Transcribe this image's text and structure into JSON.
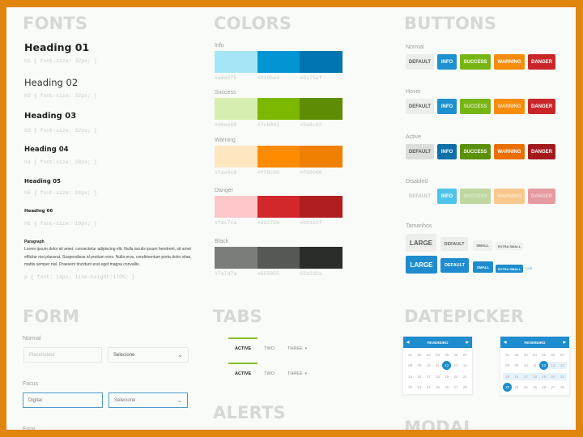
{
  "fonts": {
    "title": "FONTS",
    "headings": [
      {
        "label": "Heading 01",
        "spec": "h1 { font-size: 32px; }"
      },
      {
        "label": "Heading 02",
        "spec": "h2 { font-size: 32px; }"
      },
      {
        "label": "Heading 03",
        "spec": "h3 { font-size: 32px; }"
      },
      {
        "label": "Heading 04",
        "spec": "h4 { font-size: 28px; }"
      },
      {
        "label": "Heading 05",
        "spec": "h5 { font-size: 24px; }"
      },
      {
        "label": "Heading 06",
        "spec": "h6 { font-size: 18px; }"
      }
    ],
    "paragraph": {
      "label": "Paragraph",
      "text": "Lorem ipsum dolor sit amet, consectetur adipiscing elit. Nulla iaculis ipsum hendrerit, sit amet efficitur nisi placerat. Suspendisse id pretium eros. Nulla eros, condimentum porta dolor vitae, mattis semper nisl. Praesent tincidunt erat eget magna convallis.",
      "spec": "p { font: 14px; line-height:170%; }"
    }
  },
  "colors": {
    "title": "COLORS",
    "groups": [
      {
        "label": "Info",
        "swatches": [
          "#a6e5f5",
          "#0195d4",
          "#0175af"
        ],
        "hex": [
          "#a6e5f5",
          "#0195d4",
          "#0175af"
        ]
      },
      {
        "label": "Success",
        "swatches": [
          "#d6eeb0",
          "#7cb802",
          "#5e8c02"
        ],
        "hex": [
          "#d6eeb0",
          "#7cb802",
          "#5e8c02"
        ]
      },
      {
        "label": "Warning",
        "swatches": [
          "#fde6c0",
          "#ff8c00",
          "#f08000"
        ],
        "hex": [
          "#fde6c0",
          "#ff8c00",
          "#f08000"
        ]
      },
      {
        "label": "Danger",
        "swatches": [
          "#fdc7ca",
          "#d2272b",
          "#b01e1f"
        ],
        "hex": [
          "#fdc7ca",
          "#d2272b",
          "#b01e1f"
        ]
      },
      {
        "label": "Black",
        "swatches": [
          "#7a7d7a",
          "#555855",
          "#2a2d2a"
        ],
        "hex": [
          "#7a7d7a",
          "#555855",
          "#2a2d2a"
        ]
      }
    ]
  },
  "buttons": {
    "title": "BUTTONS",
    "states": [
      {
        "label": "Normal",
        "items": [
          "DEFAULT",
          "INFO",
          "SUCCESS",
          "WARNING",
          "DANGER"
        ]
      },
      {
        "label": "Hover",
        "items": [
          "DEFAULT",
          "INFO",
          "SUCCESS",
          "WARNING",
          "DANGER"
        ]
      },
      {
        "label": "Active",
        "items": [
          "DEFAULT",
          "INFO",
          "SUCCESS",
          "WARNING",
          "DANGER"
        ]
      },
      {
        "label": "Disabled",
        "items": [
          "DEFAULT",
          "INFO",
          "SUCCESS",
          "WARNING",
          "DANGER"
        ]
      }
    ],
    "sizes": {
      "label": "Tamanhos",
      "items": [
        "LARGE",
        "DEFAULT",
        "SMALL",
        "EXTRA SMALL"
      ],
      "link": "Link"
    }
  },
  "form": {
    "title": "FORM",
    "normal_label": "Normal",
    "focus_label": "Focus",
    "error_label": "Error",
    "input_placeholder": "Placeholder",
    "input_focus_value": "Digitar",
    "select_value": "Selecione"
  },
  "tabs": {
    "title": "TABS",
    "items": [
      "ACTIVE",
      "TWO",
      "THREE"
    ]
  },
  "alerts": {
    "title": "ALERTS"
  },
  "datepicker": {
    "title": "DATEPICKER",
    "month": "FEVEREIRO",
    "days": [
      "01",
      "02",
      "03",
      "04",
      "05",
      "06",
      "07",
      "08",
      "09",
      "10",
      "11",
      "12",
      "13",
      "14",
      "15",
      "16",
      "17",
      "18",
      "19",
      "20",
      "21",
      "22",
      "23",
      "24",
      "25",
      "26",
      "27",
      "28"
    ],
    "single_selected": "12",
    "range_start": "12",
    "range_end": "22"
  },
  "modal": {
    "title": "MODAL"
  }
}
